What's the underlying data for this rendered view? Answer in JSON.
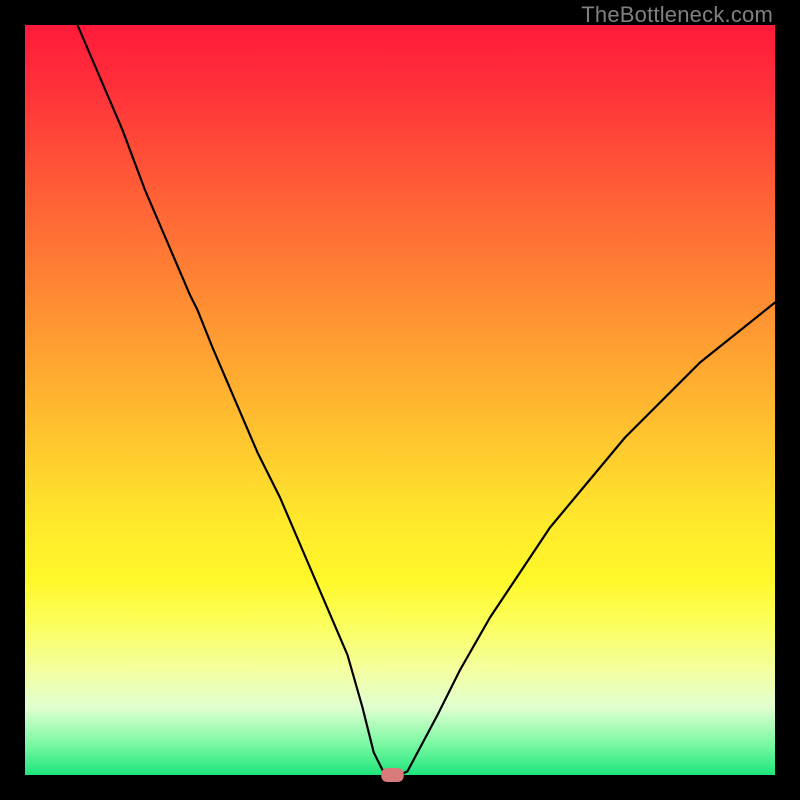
{
  "watermark": "TheBottleneck.com",
  "chart_data": {
    "type": "line",
    "title": "",
    "xlabel": "",
    "ylabel": "",
    "xlim": [
      0,
      100
    ],
    "ylim": [
      0,
      100
    ],
    "series": [
      {
        "name": "bottleneck-curve",
        "x": [
          7,
          10,
          13,
          16,
          19,
          22,
          23,
          25,
          28,
          31,
          34,
          37,
          40,
          43,
          45,
          46.5,
          48,
          49,
          50,
          51,
          55,
          58,
          62,
          66,
          70,
          75,
          80,
          85,
          90,
          95,
          100
        ],
        "y": [
          100,
          93,
          86,
          78,
          71,
          64,
          62,
          57,
          50,
          43,
          37,
          30,
          23,
          16,
          9,
          3,
          0,
          0,
          0,
          0.5,
          8,
          14,
          21,
          27,
          33,
          39,
          45,
          50,
          55,
          59,
          63
        ]
      }
    ],
    "marker": {
      "name": "target-marker",
      "x_range": [
        47.5,
        50.5
      ],
      "y": 0,
      "color": "#d97a7a"
    },
    "background_gradient": {
      "top": "#ff1a3a",
      "upper_mid": "#ff9a33",
      "mid": "#ffe82c",
      "lower_mid": "#f3ffa0",
      "bottom": "#1de57c"
    }
  }
}
